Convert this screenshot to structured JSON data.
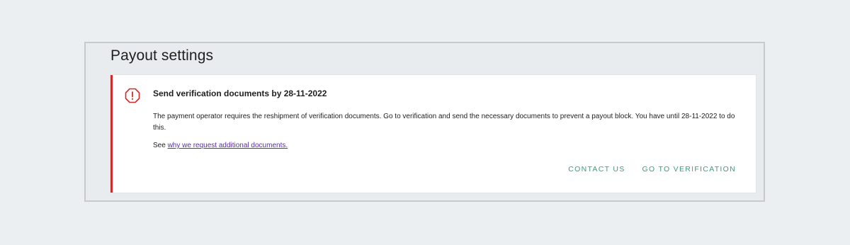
{
  "page": {
    "title": "Payout settings"
  },
  "alert": {
    "icon": "octagon-exclamation-icon",
    "title": "Send verification documents by 28-11-2022",
    "body": "The payment operator requires the reshipment of verification documents. Go to verification and send the necessary documents to prevent a payout block. You have until 28-11-2022 to do this.",
    "see_prefix": "See ",
    "see_link": "why we request additional documents.",
    "accent_color": "#d02b2b"
  },
  "actions": {
    "contact_label": "CONTACT US",
    "verify_label": "GO TO VERIFICATION",
    "color": "#3f9a7c"
  }
}
